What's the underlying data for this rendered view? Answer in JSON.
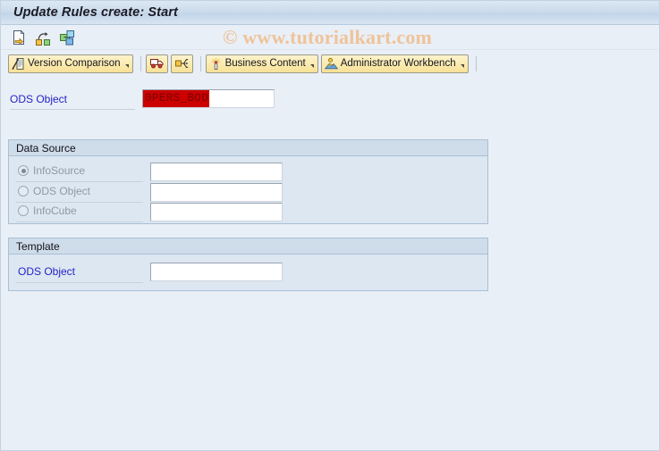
{
  "window": {
    "title": "Update Rules create: Start"
  },
  "watermark": "© www.tutorialkart.com",
  "system_toolbar": {
    "icons": [
      {
        "name": "execute-document-icon",
        "tooltip": "Create"
      },
      {
        "name": "copy-branch-icon",
        "tooltip": "Copy"
      },
      {
        "name": "multiple-objects-icon",
        "tooltip": "Objects"
      }
    ]
  },
  "app_toolbar": {
    "buttons": [
      {
        "label": "Version Comparison",
        "icon": "version-comparison-icon",
        "has_menu": true
      },
      {
        "label": "",
        "icon": "transport-truck-icon",
        "has_menu": false
      },
      {
        "label": "",
        "icon": "distribute-network-icon",
        "has_menu": false
      },
      {
        "label": "Business Content",
        "icon": "business-content-torch-icon",
        "has_menu": true
      },
      {
        "label": "Administrator Workbench",
        "icon": "administrator-workbench-icon",
        "has_menu": true
      }
    ]
  },
  "main": {
    "ods_object": {
      "label": "ODS Object",
      "value": "0PERS_BOD",
      "selected": true
    },
    "data_source": {
      "legend": "Data Source",
      "options": [
        {
          "label": "InfoSource",
          "selected": true,
          "disabled": true,
          "value": ""
        },
        {
          "label": "ODS Object",
          "selected": false,
          "disabled": true,
          "value": ""
        },
        {
          "label": "InfoCube",
          "selected": false,
          "disabled": true,
          "value": ""
        }
      ]
    },
    "template": {
      "legend": "Template",
      "field": {
        "label": "ODS Object",
        "value": ""
      }
    }
  },
  "colors": {
    "background": "#e9eff6",
    "titlebar": "#ccdcec",
    "button": "#fbebb1",
    "label_blue": "#2323c8",
    "selection_red": "#cc0000",
    "watermark": "#efc39a",
    "groupbox": "#dde7f1"
  }
}
